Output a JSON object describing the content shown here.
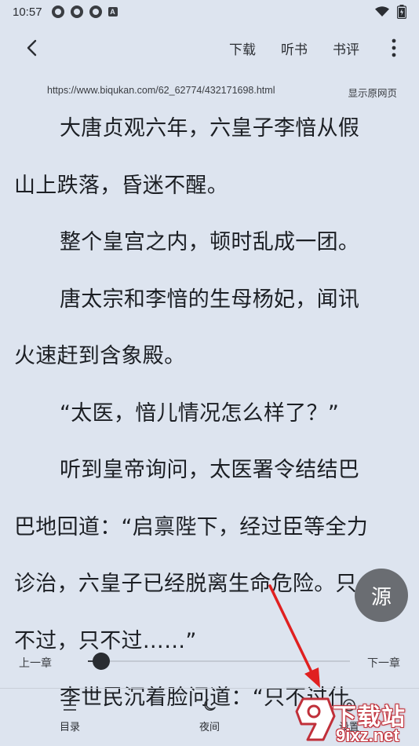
{
  "status_bar": {
    "time": "10:57",
    "notification_badge": "A"
  },
  "top_bar": {
    "actions": [
      "下载",
      "听书",
      "书评"
    ]
  },
  "source_row": {
    "url": "https://www.biqukan.com/62_62774/432171698.html",
    "show_original_label": "显示原网页"
  },
  "content": {
    "lines": [
      {
        "text": "大唐贞观六年，六皇子李愔从假",
        "indent": true
      },
      {
        "text": "山上跌落，昏迷不醒。",
        "indent": false
      },
      {
        "text": "整个皇宫之内，顿时乱成一团。",
        "indent": true
      },
      {
        "text": "唐太宗和李愔的生母杨妃，闻讯",
        "indent": true
      },
      {
        "text": "火速赶到含象殿。",
        "indent": false
      },
      {
        "text": "“太医，愔儿情况怎么样了？”",
        "indent": true
      },
      {
        "text": "听到皇帝询问，太医署令结结巴",
        "indent": true
      },
      {
        "text": "巴地回道：“启禀陛下，经过臣等全力",
        "indent": false
      },
      {
        "text": "诊治，六皇子已经脱离生命危险。只",
        "indent": false
      },
      {
        "text": "不过，只不过……”",
        "indent": false
      },
      {
        "text": "李世民沉着脸问道：“只不过什",
        "indent": true
      }
    ]
  },
  "source_button": {
    "label": "源"
  },
  "chapter_nav": {
    "prev_label": "上一章",
    "next_label": "下一章",
    "progress": 0.05
  },
  "bottom_nav": {
    "items": [
      {
        "label": "目录",
        "icon": "list-icon"
      },
      {
        "label": "夜间",
        "icon": "moon-icon"
      },
      {
        "label": "设置",
        "icon": "settings-icon"
      }
    ]
  },
  "watermark": {
    "top": "下载站",
    "bottom": "9ixz.net"
  },
  "colors": {
    "background": "#dde4ef",
    "text": "#1c1f24",
    "source_button": "#6a6d72",
    "annotation_arrow": "#e02020"
  }
}
